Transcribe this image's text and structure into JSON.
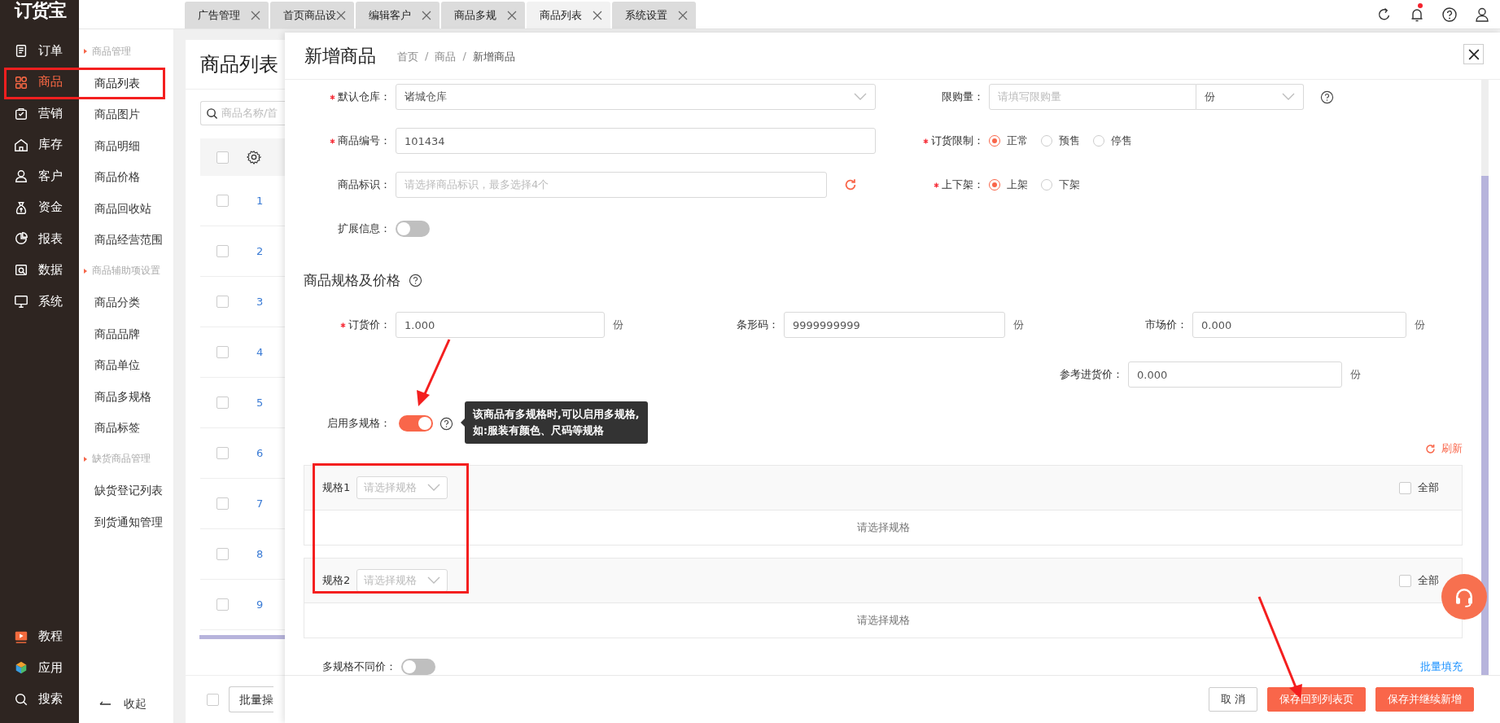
{
  "logo": "订货宝",
  "nav": [
    {
      "label": "订单",
      "selected": false
    },
    {
      "label": "商品",
      "selected": true
    },
    {
      "label": "营销",
      "selected": false
    },
    {
      "label": "库存",
      "selected": false
    },
    {
      "label": "客户",
      "selected": false
    },
    {
      "label": "资金",
      "selected": false
    },
    {
      "label": "报表",
      "selected": false
    },
    {
      "label": "数据",
      "selected": false
    },
    {
      "label": "系统",
      "selected": false
    }
  ],
  "nav_bottom": [
    {
      "label": "教程"
    },
    {
      "label": "应用"
    },
    {
      "label": "搜索"
    }
  ],
  "subnav": {
    "items": [
      {
        "kind": "header",
        "label": "商品管理"
      },
      {
        "kind": "link",
        "label": "商品列表",
        "selected": true
      },
      {
        "kind": "link",
        "label": "商品图片",
        "selected": false
      },
      {
        "kind": "link",
        "label": "商品明细",
        "selected": false
      },
      {
        "kind": "link",
        "label": "商品价格",
        "selected": false
      },
      {
        "kind": "link",
        "label": "商品回收站",
        "selected": false
      },
      {
        "kind": "link",
        "label": "商品经营范围",
        "selected": false
      },
      {
        "kind": "header",
        "label": "商品辅助项设置"
      },
      {
        "kind": "link",
        "label": "商品分类",
        "selected": false
      },
      {
        "kind": "link",
        "label": "商品品牌",
        "selected": false
      },
      {
        "kind": "link",
        "label": "商品单位",
        "selected": false
      },
      {
        "kind": "link",
        "label": "商品多规格",
        "selected": false
      },
      {
        "kind": "link",
        "label": "商品标签",
        "selected": false
      },
      {
        "kind": "header",
        "label": "缺货商品管理"
      },
      {
        "kind": "link",
        "label": "缺货登记列表",
        "selected": false
      },
      {
        "kind": "link",
        "label": "到货通知管理",
        "selected": false
      }
    ],
    "collapse": "收起"
  },
  "tabs": [
    {
      "label": "广告管理",
      "selected": false
    },
    {
      "label": "首页商品设",
      "selected": false
    },
    {
      "label": "编辑客户",
      "selected": false
    },
    {
      "label": "商品多规",
      "selected": false
    },
    {
      "label": "商品列表",
      "selected": true
    },
    {
      "label": "系统设置",
      "selected": false
    }
  ],
  "notifications": {
    "unread": true
  },
  "list_page": {
    "title": "商品列表",
    "search_placeholder": "商品名称/首",
    "header_checked": false,
    "rows": [
      {
        "number": "1",
        "checked": false
      },
      {
        "number": "2",
        "checked": false
      },
      {
        "number": "3",
        "checked": false
      },
      {
        "number": "4",
        "checked": false
      },
      {
        "number": "5",
        "checked": false
      },
      {
        "number": "6",
        "checked": false
      },
      {
        "number": "7",
        "checked": false
      },
      {
        "number": "8",
        "checked": false
      },
      {
        "number": "9",
        "checked": false
      }
    ],
    "footer_checked": false,
    "batch_button": "批量操"
  },
  "dialog": {
    "title": "新增商品",
    "breadcrumb": [
      "首页",
      "商品",
      "新增商品"
    ],
    "separator": "/",
    "top_rows": [
      [
        {
          "kind": "select",
          "label": "默认仓库：",
          "required": true,
          "value": "诸城仓库"
        },
        {
          "kind": "quantity",
          "label": "限购量：",
          "required": false,
          "placeholder": "请填写限购量",
          "unit": "份",
          "help": true
        }
      ],
      [
        {
          "kind": "input",
          "label": "商品编号：",
          "required": true,
          "value": "101434"
        },
        {
          "kind": "radio",
          "label": "订货限制：",
          "required": true,
          "options": [
            {
              "label": "正常",
              "selected": true
            },
            {
              "label": "预售",
              "selected": false
            },
            {
              "label": "停售",
              "selected": false
            }
          ]
        }
      ],
      [
        {
          "kind": "tags",
          "label": "商品标识：",
          "required": false,
          "placeholder": "请选择商品标识，最多选择4个"
        },
        {
          "kind": "radio",
          "label": "上下架：",
          "required": true,
          "options": [
            {
              "label": "上架",
              "selected": true
            },
            {
              "label": "下架",
              "selected": false
            }
          ]
        }
      ],
      [
        {
          "kind": "toggle",
          "label": "扩展信息：",
          "required": false,
          "on": false
        }
      ]
    ],
    "section": {
      "title": "商品规格及价格",
      "help": true
    },
    "price_fields": [
      {
        "label": "订货价：",
        "required": true,
        "value": "1.000",
        "unit": "份"
      },
      {
        "label": "条形码：",
        "required": false,
        "value": "9999999999",
        "unit": "份"
      },
      {
        "label": "市场价：",
        "required": false,
        "value": "0.000",
        "unit": "份"
      },
      {
        "label": "参考进货价：",
        "required": false,
        "value": "0.000",
        "unit": "份"
      }
    ],
    "multi_spec": {
      "label": "启用多规格：",
      "on": true,
      "tooltip": [
        "该商品有多规格时,可以启用多规格,",
        "如:服装有颜色、尺码等规格"
      ]
    },
    "refresh": "刷新",
    "specs": [
      {
        "label": "规格1",
        "placeholder": "请选择规格",
        "all_label": "全部",
        "all_checked": false,
        "empty_text": "请选择规格"
      },
      {
        "label": "规格2",
        "placeholder": "请选择规格",
        "all_label": "全部",
        "all_checked": false,
        "empty_text": "请选择规格"
      }
    ],
    "price_mismatch": {
      "label": "多规格不同价：",
      "on": false
    },
    "batch_fill": "批量填充",
    "buttons": [
      {
        "label": "取 消",
        "kind": "default"
      },
      {
        "label": "保存回到列表页",
        "kind": "primary"
      },
      {
        "label": "保存并继续新增",
        "kind": "primary"
      }
    ]
  }
}
